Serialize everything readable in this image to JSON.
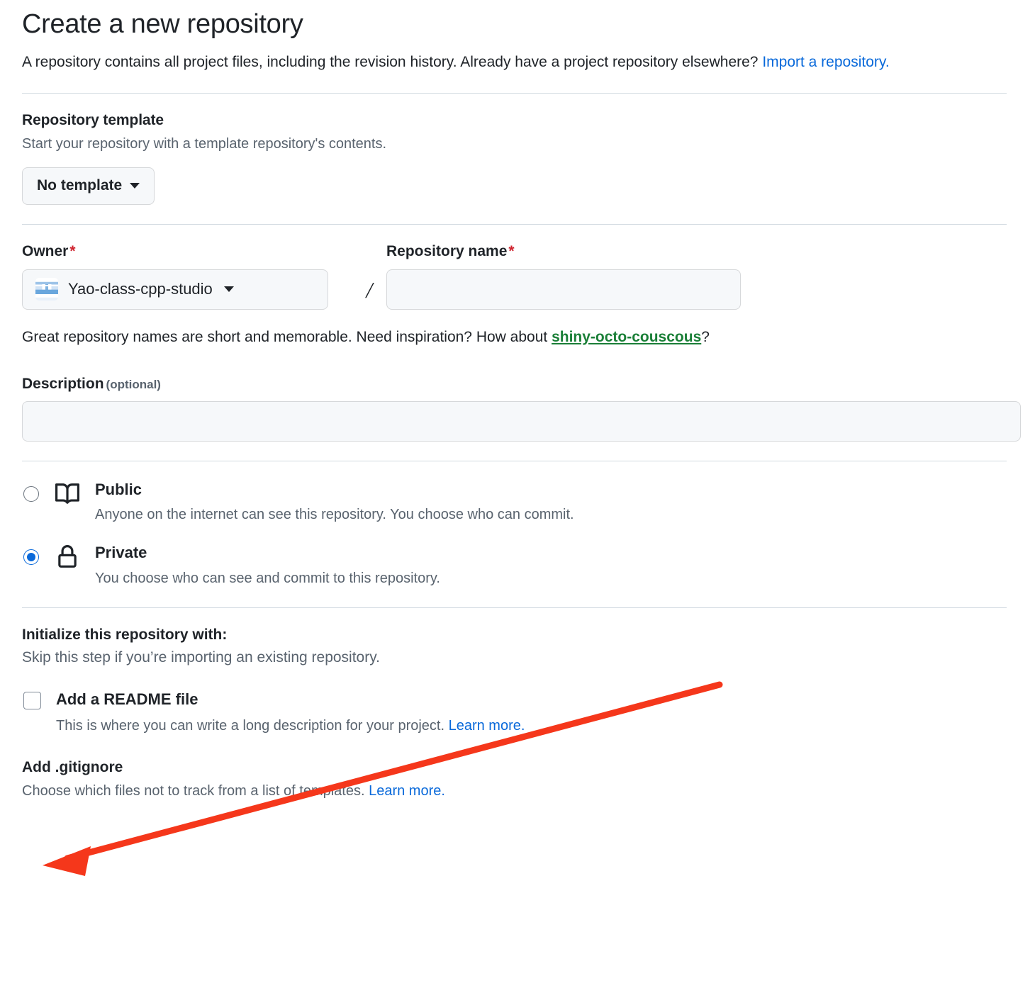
{
  "page": {
    "title": "Create a new repository",
    "lede_before_link": "A repository contains all project files, including the revision history. Already have a project repository elsewhere? ",
    "lede_link": "Import a repository.",
    "lede_after_link": ""
  },
  "template_section": {
    "heading": "Repository template",
    "subtext": "Start your repository with a template repository's contents.",
    "button_label": "No template",
    "button_icon": "chevron-down-icon"
  },
  "owner_section": {
    "owner_label": "Owner",
    "owner_required_mark": "*",
    "owner_value": "Yao-class-cpp-studio",
    "owner_avatar_icon": "user-avatar-identicon",
    "owner_caret_icon": "chevron-down-icon",
    "separator": "/",
    "repo_name_label": "Repository name",
    "repo_name_required_mark": "*",
    "repo_name_value": "",
    "repo_name_placeholder": "",
    "hint_before": "Great repository names are short and memorable. Need inspiration? How about ",
    "hint_suggestion": "shiny-octo-couscous",
    "hint_after": "?"
  },
  "description_section": {
    "label": "Description",
    "optional_label": "(optional)",
    "value": "",
    "placeholder": ""
  },
  "visibility": {
    "options": [
      {
        "id": "public",
        "name": "Public",
        "description": "Anyone on the internet can see this repository. You choose who can commit.",
        "icon": "repo-book-icon",
        "selected": false
      },
      {
        "id": "private",
        "name": "Private",
        "description": "You choose who can see and commit to this repository.",
        "icon": "lock-icon",
        "selected": true
      }
    ]
  },
  "initialize_section": {
    "heading": "Initialize this repository with:",
    "subtext": "Skip this step if you’re importing an existing repository.",
    "readme": {
      "label": "Add a README file",
      "checked": false,
      "description_before": "This is where you can write a long description for your project. ",
      "description_link": "Learn more."
    },
    "gitignore": {
      "heading": "Add .gitignore",
      "description_before": "Choose which files not to track from a list of templates. ",
      "description_link": "Learn more."
    }
  },
  "annotation": {
    "arrow_color": "#f5371b",
    "arrow_name": "red-pointer-arrow",
    "points_at": "Add a README file checkbox"
  },
  "colors": {
    "link": "#0969da",
    "required": "#cf222e",
    "suggestion_green": "#1a7f37",
    "muted_text": "#59636e",
    "body_text": "#1f2328",
    "field_bg": "#f6f8fa",
    "border": "#d1d9e0"
  }
}
